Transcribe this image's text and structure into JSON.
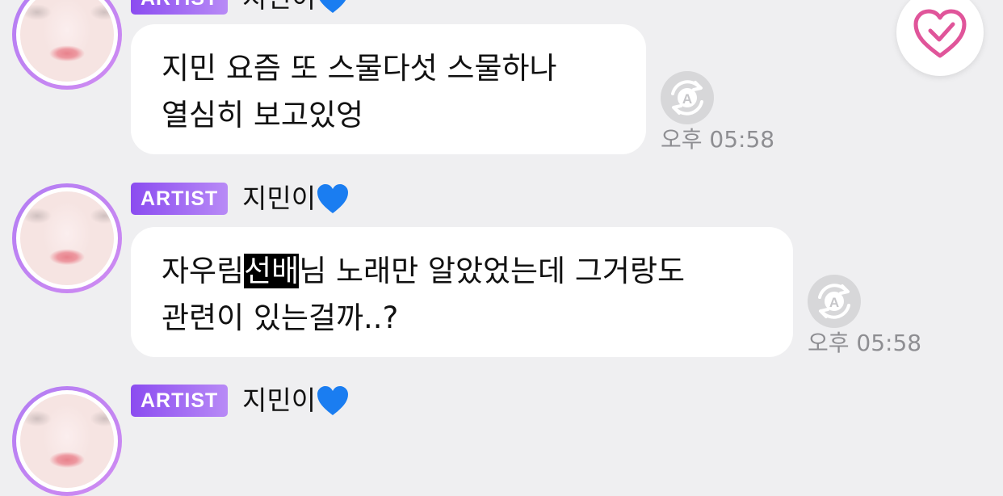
{
  "messages": [
    {
      "badge": "ARTIST",
      "author": "지민이",
      "lines": [
        "지민 요즘 또 스물다섯 스물하나",
        "열심히 보고있엉"
      ],
      "time": "오후 05:58"
    },
    {
      "badge": "ARTIST",
      "author": "지민이",
      "line1_pre": "자우림",
      "line1_highlight": "선배",
      "line1_post": "님 노래만 알았었는데 그거랑도",
      "line2": "관련이 있는걸까..?",
      "time": "오후 05:58"
    },
    {
      "badge": "ARTIST",
      "author": "지민이"
    }
  ],
  "icons": {
    "author_suffix": "blue-heart-icon",
    "translate": "translate-icon",
    "like": "heart-outline-icon"
  },
  "colors": {
    "background": "#efeff1",
    "badge_gradient_start": "#8b4cf0",
    "badge_gradient_end": "#b88af6",
    "like_heart": "#e0559a",
    "timestamp": "#8e8e92"
  }
}
